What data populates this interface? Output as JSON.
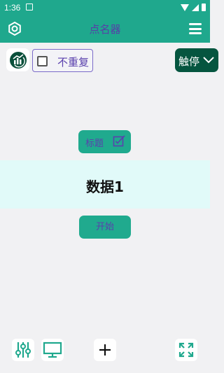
{
  "status_bar": {
    "time": "1:36",
    "icons": [
      "app-notification-icon",
      "wifi-icon",
      "signal-icon",
      "battery-icon"
    ]
  },
  "app_bar": {
    "title": "点名器",
    "left_icon": "settings-icon",
    "right_icon": "menu-icon",
    "background": "#1fa88d",
    "title_color": "#5640a8"
  },
  "toolbar": {
    "chart_icon": "chart-icon",
    "no_repeat": {
      "label": "不重复",
      "checked": false
    },
    "touch_stop": {
      "label": "触停",
      "icon": "chevron-down-icon",
      "background": "#05553f"
    }
  },
  "main": {
    "title_button": {
      "label": "标题",
      "icon": "edit-icon"
    },
    "result": "数据1",
    "result_background": "#e1faf9",
    "start_button": {
      "label": "开始"
    }
  },
  "bottom_bar": {
    "icons": [
      "sliders-icon",
      "monitor-icon",
      "plus-icon",
      "fullscreen-icon"
    ],
    "accent": "#1fa88d"
  }
}
